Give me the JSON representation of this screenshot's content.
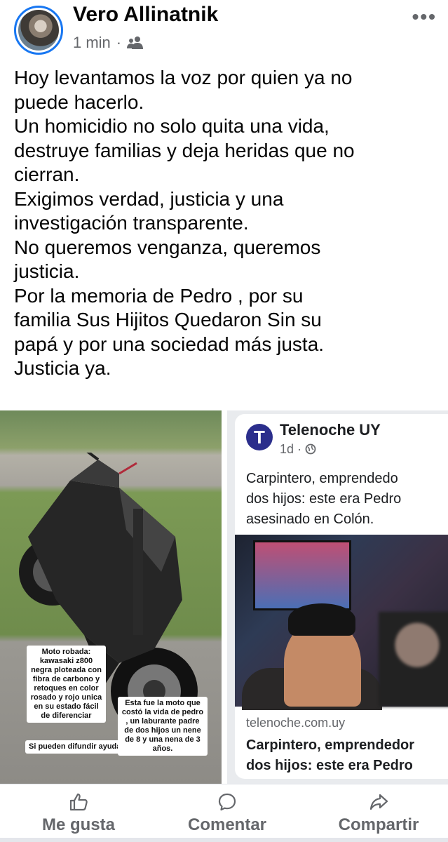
{
  "post": {
    "author": "Vero Allinatnik",
    "time": "1 min",
    "separator": "·",
    "audience_icon": "friends-icon",
    "more_icon": "more-dots-icon",
    "text_lines": [
      "Hoy levantamos la voz por quien ya no",
      "puede hacerlo.",
      "Un homicidio no solo quita una vida,",
      "destruye familias y deja heridas que no",
      "cierran.",
      "Exigimos verdad, justicia y una",
      "investigación transparente.",
      "No queremos venganza, queremos",
      "justicia.",
      "Por la memoria de Pedro , por su",
      "familia Sus Hijitos Quedaron Sin su",
      "papá  y por una sociedad más justa.",
      "Justicia ya."
    ]
  },
  "media_left": {
    "caption_stolen": "Moto robada: kawasaki z800 negra ploteada con fibra de carbono y retoques en color rosado y rojo unica en su estado fácil de diferenciar",
    "caption_help": "Si pueden difundir ayuda ♥",
    "caption_story": "Esta fue la moto que costó la vida de pedro , un laburante padre de dos hijos un nene de 8 y una nena de 3 años."
  },
  "media_right": {
    "page_name": "Telenoche UY",
    "logo_letter": "T",
    "page_meta": "1d ·",
    "globe_icon": "globe-icon",
    "headline_lines": [
      "Carpintero, emprendedo",
      "dos hijos: este era Pedro",
      "asesinado en Colón."
    ],
    "link": "telenoche.com.uy",
    "link_headline_lines": [
      "Carpintero, emprendedor",
      "dos hijos: este era Pedro"
    ]
  },
  "actions": {
    "like": "Me gusta",
    "comment": "Comentar",
    "share": "Compartir"
  },
  "colors": {
    "accent": "#1877f2",
    "secondary_text": "#65676b",
    "telenoche_brand": "#2b2e8c"
  }
}
